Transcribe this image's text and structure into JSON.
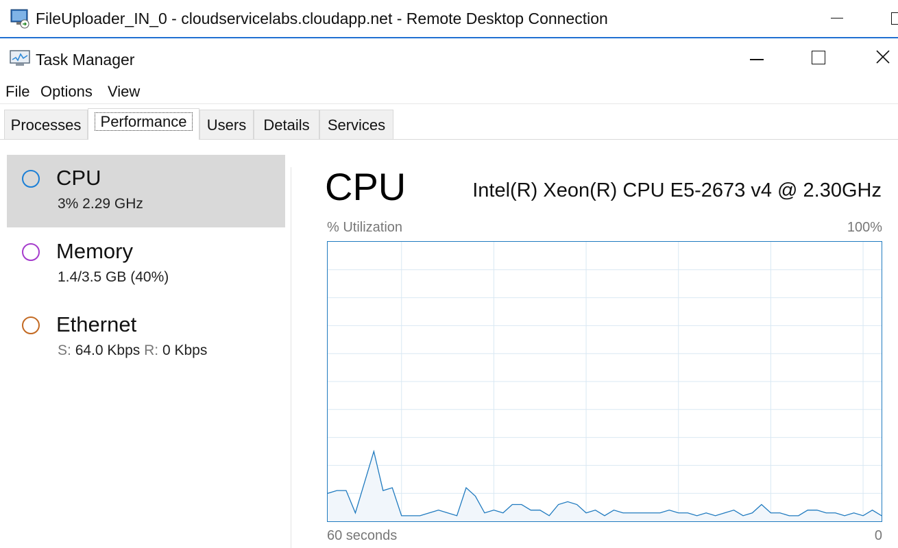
{
  "rdp": {
    "title": "FileUploader_IN_0 - cloudservicelabs.cloudapp.net - Remote Desktop Connection"
  },
  "window": {
    "title": "Task Manager"
  },
  "menu": {
    "items": [
      "File",
      "Options",
      "View"
    ]
  },
  "tabs": [
    "Processes",
    "Performance",
    "Users",
    "Details",
    "Services"
  ],
  "active_tab": "Performance",
  "resources": [
    {
      "name": "CPU",
      "value": "3%  2.29 GHz",
      "color": "#1b7fd6"
    },
    {
      "name": "Memory",
      "value": "1.4/3.5 GB (40%)",
      "color": "#a53bcc"
    },
    {
      "name": "Ethernet",
      "send_label": "S:",
      "send_value": "64.0 Kbps",
      "recv_label": "R:",
      "recv_value": "0 Kbps",
      "color": "#c36a23"
    }
  ],
  "detail": {
    "title": "CPU",
    "model": "Intel(R) Xeon(R) CPU E5-2673 v4 @ 2.30GHz",
    "y_label": "% Utilization",
    "y_max_label": "100%",
    "x_left_label": "60 seconds",
    "x_right_label": "0"
  },
  "colors": {
    "line": "#1f7abf",
    "fill": "#f1f6fb",
    "grid": "#d9e8f3",
    "border": "#1f7abf"
  },
  "chart_data": {
    "type": "area",
    "xlabel": "60 seconds",
    "ylabel": "% Utilization",
    "xlim": [
      60,
      0
    ],
    "ylim": [
      0,
      100
    ],
    "grid": true,
    "x": [
      60,
      59,
      58,
      57,
      56,
      55,
      54,
      53,
      52,
      51,
      50,
      49,
      48,
      47,
      46,
      45,
      44,
      43,
      42,
      41,
      40,
      39,
      38,
      37,
      36,
      35,
      34,
      33,
      32,
      31,
      30,
      29,
      28,
      27,
      26,
      25,
      24,
      23,
      22,
      21,
      20,
      19,
      18,
      17,
      16,
      15,
      14,
      13,
      12,
      11,
      10,
      9,
      8,
      7,
      6,
      5,
      4,
      3,
      2,
      1,
      0
    ],
    "series": [
      {
        "values": [
          10,
          11,
          11,
          3,
          14,
          25,
          11,
          12,
          2,
          2,
          2,
          3,
          4,
          3,
          2,
          12,
          9,
          3,
          4,
          3,
          6,
          6,
          4,
          4,
          2,
          6,
          7,
          6,
          3,
          4,
          2,
          4,
          3,
          3,
          3,
          3,
          3,
          4,
          3,
          3,
          2,
          3,
          2,
          3,
          4,
          2,
          3,
          6,
          3,
          3,
          2,
          2,
          4,
          4,
          3,
          3,
          2,
          3,
          2,
          4,
          2
        ]
      }
    ]
  }
}
